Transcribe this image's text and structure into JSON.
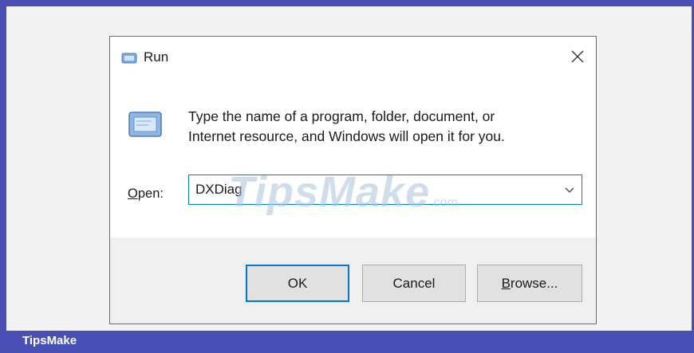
{
  "footer": {
    "brand": "TipsMake"
  },
  "dialog": {
    "title": "Run",
    "icon": "run-icon",
    "close_icon": "close-icon",
    "description_line1": "Type the name of a program, folder, document, or",
    "description_line2": "Internet resource, and Windows will open it for you.",
    "open_label_accel": "O",
    "open_label_rest": "pen:",
    "open_value": "DXDiag",
    "dropdown_icon": "chevron-down-icon",
    "buttons": {
      "ok": "OK",
      "cancel": "Cancel",
      "browse_accel": "B",
      "browse_rest": "rowse..."
    }
  },
  "watermark": {
    "text": "TipsMake",
    "suffix": ".com"
  },
  "colors": {
    "frame": "#4a50b3",
    "accent": "#0078d7",
    "button_bar": "#f0f0f0"
  }
}
